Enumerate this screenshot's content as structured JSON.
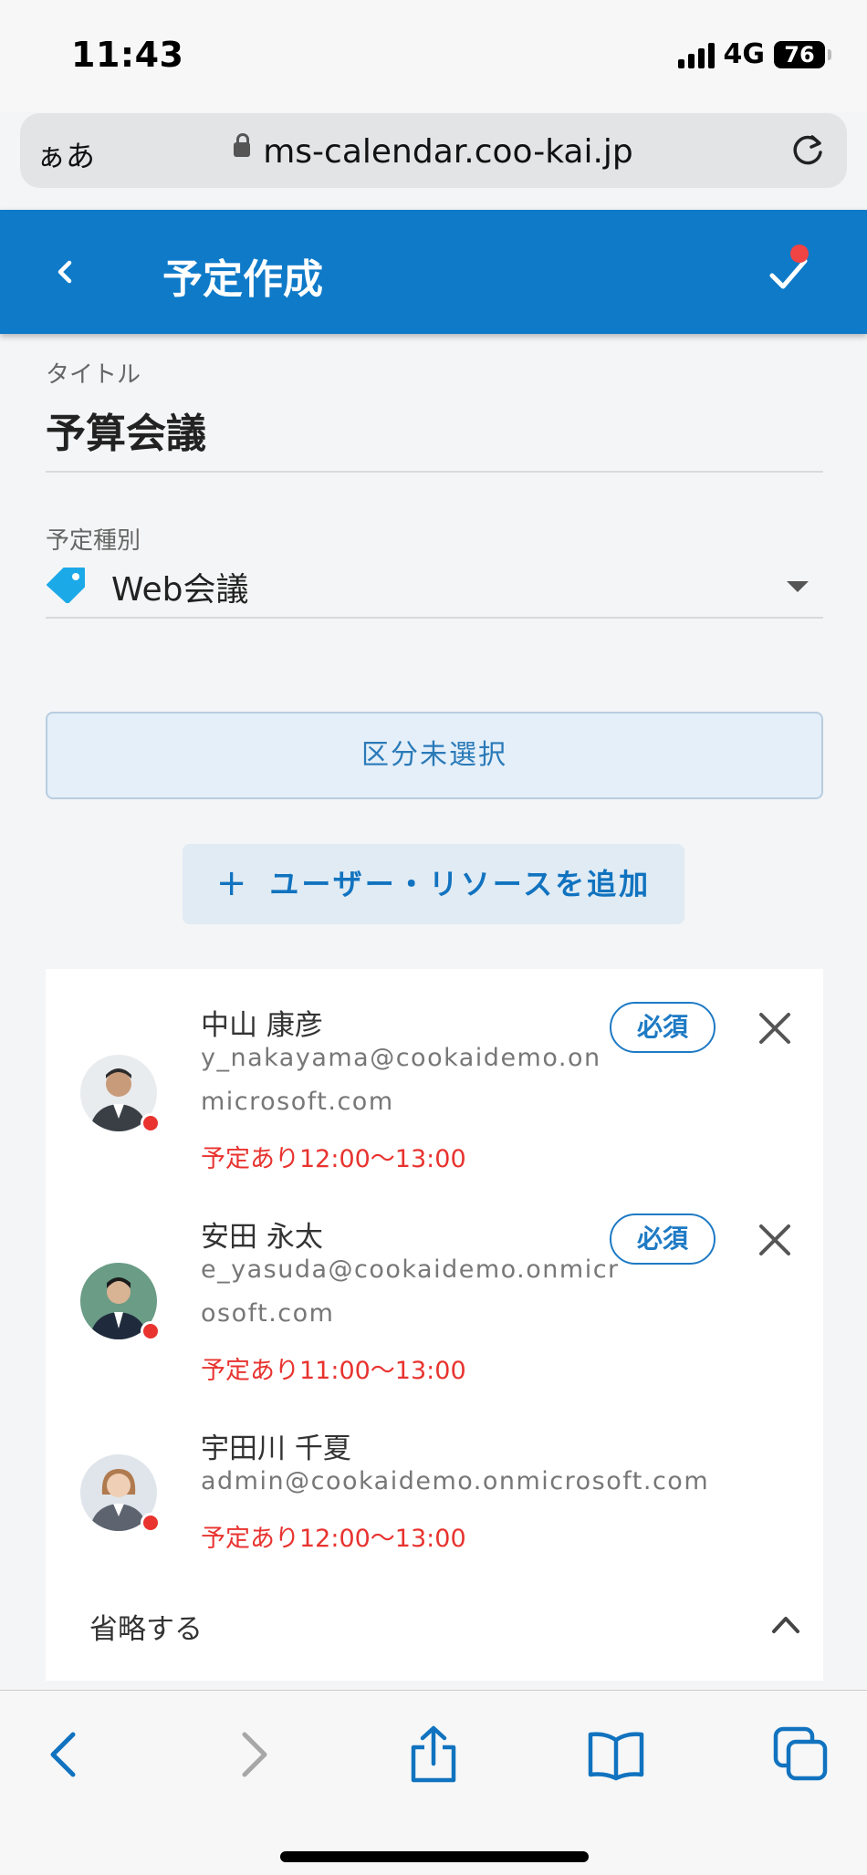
{
  "status_bar": {
    "time": "11:43",
    "network": "4G",
    "battery": "76"
  },
  "browser": {
    "text_size": "ぁあ",
    "url": "ms-calendar.coo-kai.jp"
  },
  "header": {
    "title": "予定作成"
  },
  "form": {
    "title_label": "タイトル",
    "title_value": "予算会議",
    "type_label": "予定種別",
    "type_value": "Web会議",
    "kubun_button": "区分未選択",
    "add_button_icon": "+",
    "add_button": "ユーザー・リソースを追加"
  },
  "participants": [
    {
      "name": "中山 康彦",
      "email": "y_nakayama@cookaidemo.onmicrosoft.com",
      "status": "予定あり12:00〜13:00",
      "badge": "必須"
    },
    {
      "name": "安田 永太",
      "email": "e_yasuda@cookaidemo.onmicrosoft.com",
      "status": "予定あり11:00〜13:00",
      "badge": "必須"
    },
    {
      "name": "宇田川 千夏",
      "email": "admin@cookaidemo.onmicrosoft.com",
      "status": "予定あり12:00〜13:00"
    }
  ],
  "collapse_label": "省略する",
  "colors": {
    "primary": "#0e7ac8",
    "alert": "#e8332f",
    "tag": "#1ba9e8"
  },
  "icons": [
    "back-icon",
    "check-icon",
    "lock-icon",
    "reload-icon",
    "tag-icon",
    "close-icon",
    "chevron-up-icon",
    "share-icon",
    "bookmarks-icon",
    "tabs-icon"
  ]
}
